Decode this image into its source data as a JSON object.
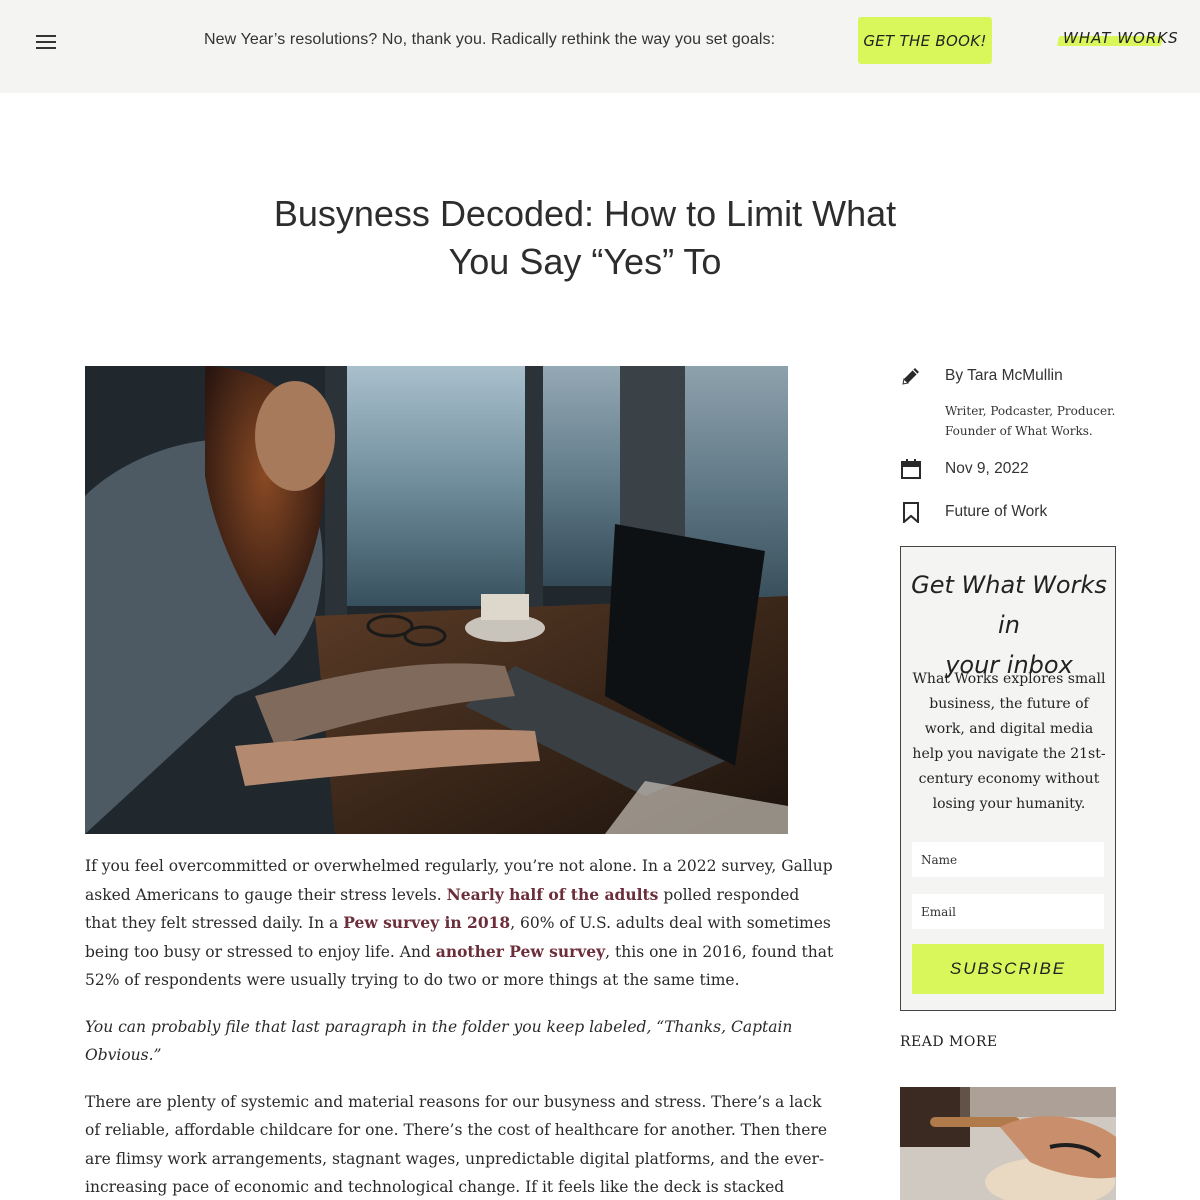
{
  "header": {
    "menu_icon": "hamburger-menu-icon",
    "promo_text": "New Year’s resolutions? No, thank you. Radically rethink the way you set goals:",
    "cta_label": "GET THE BOOK!",
    "logo_text": "WHAT WORKS"
  },
  "article": {
    "title_line1": "Busyness Decoded: How to Limit What",
    "title_line2": "You Say “Yes” To",
    "p1_a": "If you feel overcommitted or overwhelmed regularly, you’re not alone. In a 2022 survey, Gallup asked Americans to gauge their stress levels. ",
    "p1_link1": "Nearly half of the adults",
    "p1_b": " polled responded that they felt stressed daily. In a ",
    "p1_link2": "Pew survey in 2018",
    "p1_c": ", 60% of U.S. adults deal with sometimes being too busy or stressed to enjoy life. And ",
    "p1_link3": "another Pew survey",
    "p1_d": ", this one in 2016, found that 52% of respondents were usually trying to do two or more things at the same time.",
    "p2": "You can probably file that last paragraph in the folder you keep labeled, “Thanks, Captain Obvious.”",
    "p3": "There are plenty of systemic and material reasons for our busyness and stress. There’s a lack of reliable, affordable childcare for one. There’s the cost of healthcare for another. Then there are flimsy work arrangements, stagnant wages, unpredictable digital platforms, and the ever-increasing pace of economic and technological change. If it feels like the deck is stacked against our ability to live a life that’s only moderately stressful, it’s because it is."
  },
  "sidebar": {
    "author": "By Tara McMullin",
    "bio_line1": "Writer, Podcaster, Producer.",
    "bio_line2": "Founder of What Works.",
    "date": "Nov 9, 2022",
    "category": "Future of Work",
    "icons": [
      "pencil-icon",
      "calendar-icon",
      "bookmark-icon"
    ]
  },
  "newsletter": {
    "title_line1": "Get What Works in",
    "title_line2": "your inbox",
    "description": "What Works explores small business, the future of work, and digital media help you navigate the 21st-century economy without losing your humanity.",
    "name_placeholder": "Name",
    "email_placeholder": "Email",
    "subscribe_label": "SUBSCRIBE"
  },
  "read_more": {
    "heading": "READ MORE"
  },
  "colors": {
    "accent": "#d9f75a",
    "link": "#6b2e3a",
    "topbar_bg": "#f4f4f2"
  }
}
